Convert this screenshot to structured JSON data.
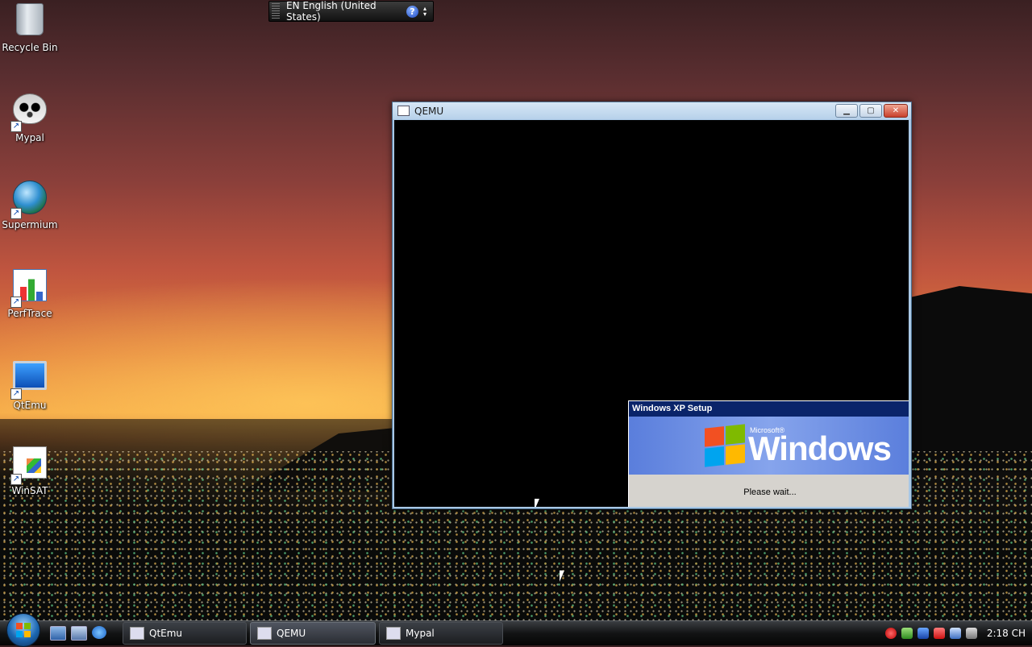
{
  "language_bar": {
    "label": "EN English (United States)",
    "help": "?"
  },
  "desktop_icons": [
    {
      "label": "Recycle Bin"
    },
    {
      "label": "Mypal"
    },
    {
      "label": "Supermium"
    },
    {
      "label": "PerfTrace"
    },
    {
      "label": "QtEmu"
    },
    {
      "label": "WinSAT"
    }
  ],
  "qemu_window": {
    "title": "QEMU",
    "buttons": {
      "minimize": "▁",
      "maximize": "▢",
      "close": "✕"
    },
    "xp_setup": {
      "title": "Windows XP Setup",
      "brand_small": "Microsoft®",
      "brand_word": "Windows",
      "message": "Please wait..."
    }
  },
  "taskbar": {
    "buttons": [
      {
        "label": "QtEmu"
      },
      {
        "label": "QEMU"
      },
      {
        "label": "Mypal"
      }
    ],
    "clock": "2:18 CH"
  }
}
